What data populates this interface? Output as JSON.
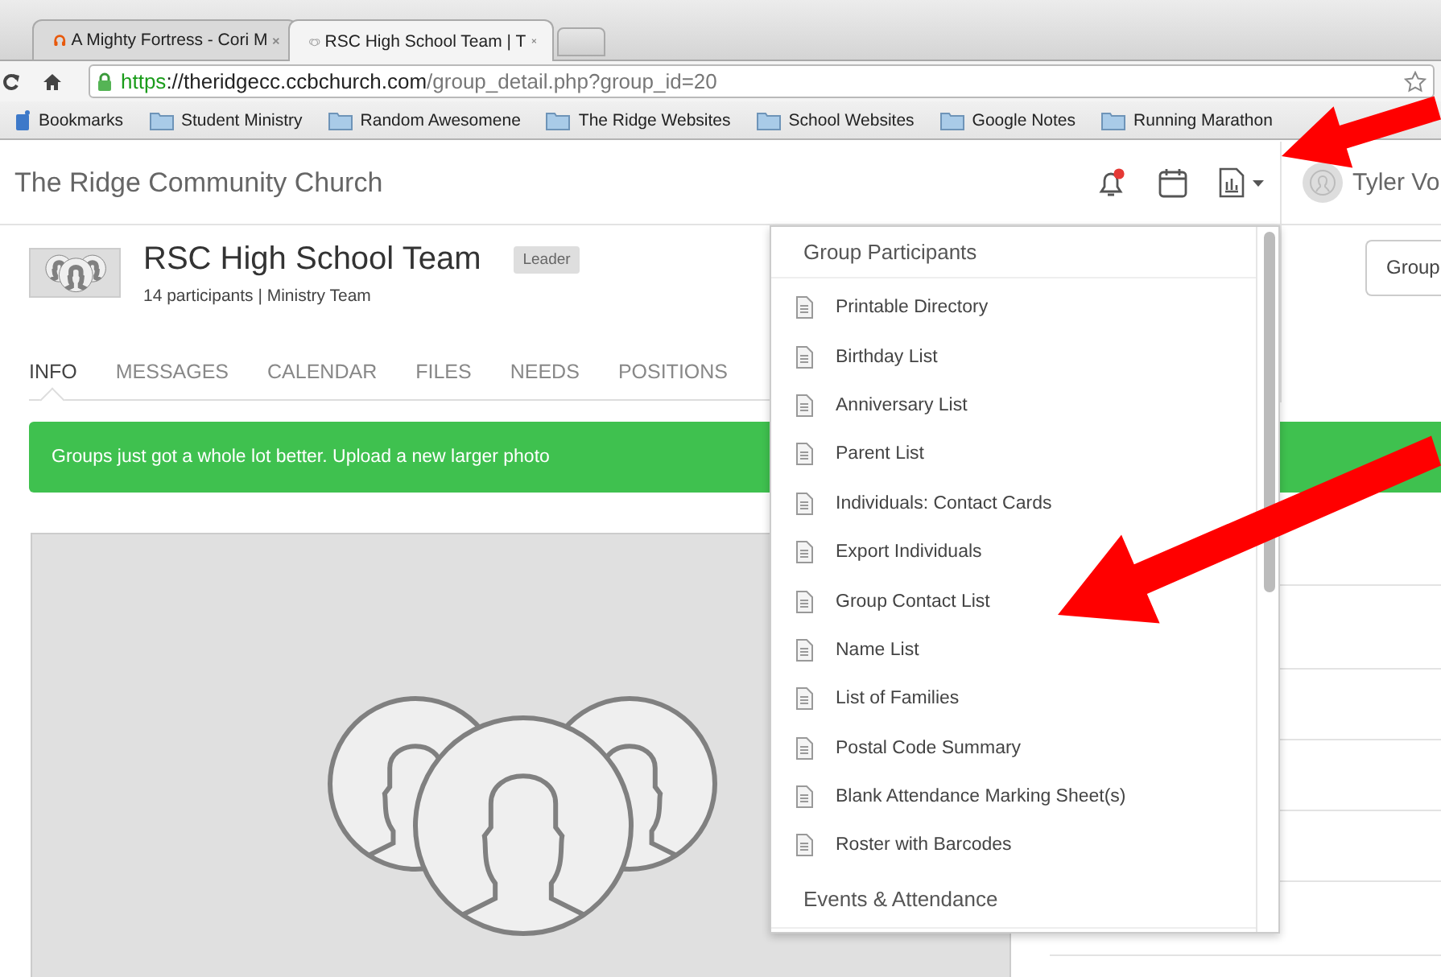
{
  "browser": {
    "tabs": [
      {
        "title": "A Mighty Fortress - Cori M",
        "kind": "audio",
        "selected": false
      },
      {
        "title": "RSC High School Team | T",
        "kind": "group",
        "selected": true
      }
    ],
    "url": "https://theridgecc.ccbchurch.com/group_detail.php?group_id=20",
    "bookmarks": [
      {
        "label": "Bookmarks",
        "kind": "apps"
      },
      {
        "label": "Student Ministry",
        "kind": "folder"
      },
      {
        "label": "Random Awesomene",
        "kind": "folder"
      },
      {
        "label": "The Ridge Websites",
        "kind": "folder"
      },
      {
        "label": "School Websites",
        "kind": "folder"
      },
      {
        "label": "Google Notes",
        "kind": "folder"
      },
      {
        "label": "Running Marathon",
        "kind": "folder"
      }
    ]
  },
  "header": {
    "site_title": "The Ridge Community Church",
    "notifications": {
      "unread": true
    },
    "user_name": "Tyler Vo"
  },
  "group": {
    "name": "RSC High School Team",
    "role_badge": "Leader",
    "summary": "14 participants | Ministry Team",
    "tabs": [
      {
        "label": "INFO",
        "selected": true
      },
      {
        "label": "MESSAGES",
        "selected": false
      },
      {
        "label": "CALENDAR",
        "selected": false
      },
      {
        "label": "FILES",
        "selected": false
      },
      {
        "label": "NEEDS",
        "selected": false
      },
      {
        "label": "POSITIONS",
        "selected": false
      }
    ],
    "action_button": "Group"
  },
  "banner": "Groups just got a whole lot better. Upload a new larger photo",
  "reports_menu": {
    "sections": [
      {
        "heading": "Group Participants",
        "items": [
          "Printable Directory",
          "Birthday List",
          "Anniversary List",
          "Parent List",
          "Individuals: Contact Cards",
          "Export Individuals",
          "Group Contact List",
          "Name List",
          "List of Families",
          "Postal Code Summary",
          "Blank Attendance Marking Sheet(s)",
          "Roster with Barcodes"
        ]
      },
      {
        "heading": "Events & Attendance"
      }
    ]
  },
  "annotations": [
    {
      "kind": "arrow"
    },
    {
      "kind": "arrow"
    }
  ]
}
